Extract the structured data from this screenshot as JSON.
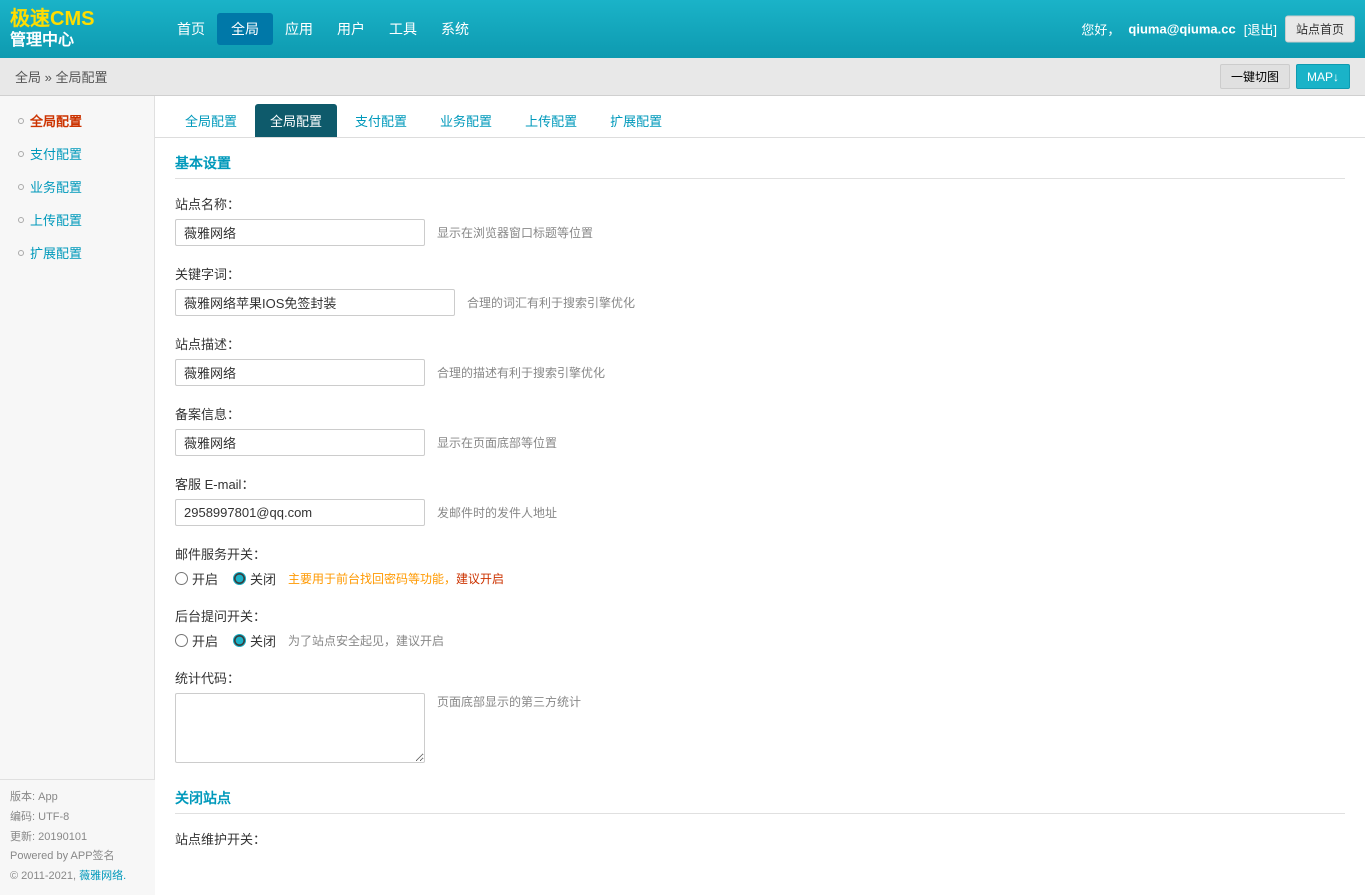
{
  "logo": {
    "line1": "极速CMS",
    "line2": "管理中心"
  },
  "nav": {
    "items": [
      {
        "label": "首页",
        "active": false
      },
      {
        "label": "全局",
        "active": true
      },
      {
        "label": "应用",
        "active": false
      },
      {
        "label": "用户",
        "active": false
      },
      {
        "label": "工具",
        "active": false
      },
      {
        "label": "系统",
        "active": false
      }
    ]
  },
  "topRight": {
    "greeting": "您好，",
    "username": "qiuma@qiuma.cc",
    "logout": "退出",
    "siteHome": "站点首页"
  },
  "breadcrumb": {
    "root": "全局",
    "separator": "»",
    "current": "全局配置",
    "actions": [
      {
        "label": "一键切图"
      },
      {
        "label": "MAP↓"
      }
    ]
  },
  "sidebar": {
    "items": [
      {
        "label": "全局配置",
        "active": true
      },
      {
        "label": "支付配置",
        "active": false
      },
      {
        "label": "业务配置",
        "active": false
      },
      {
        "label": "上传配置",
        "active": false
      },
      {
        "label": "扩展配置",
        "active": false
      }
    ],
    "footer": {
      "version_label": "版本:",
      "version_value": "App",
      "encoding_label": "编码:",
      "encoding_value": "UTF-8",
      "update_label": "更新:",
      "update_value": "20190101",
      "powered_by": "Powered by APP签名",
      "copyright": "© 2011-2021,",
      "copyright_link": "薇雅网络."
    }
  },
  "subTabs": [
    {
      "label": "全局配置",
      "state": "link"
    },
    {
      "label": "全局配置",
      "state": "active"
    },
    {
      "label": "支付配置",
      "state": "normal"
    },
    {
      "label": "业务配置",
      "state": "normal"
    },
    {
      "label": "上传配置",
      "state": "normal"
    },
    {
      "label": "扩展配置",
      "state": "normal"
    }
  ],
  "basicSettings": {
    "title": "基本设置",
    "fields": {
      "siteName": {
        "label": "站点名称：",
        "value": "薇雅网络",
        "hint": "显示在浏览器窗口标题等位置"
      },
      "keywords": {
        "label": "关键字词：",
        "value": "薇雅网络苹果IOS免签封装",
        "hint": "合理的词汇有利于搜索引擎优化"
      },
      "description": {
        "label": "站点描述：",
        "value": "薇雅网络",
        "hint": "合理的描述有利于搜索引擎优化"
      },
      "icp": {
        "label": "备案信息：",
        "value": "薇雅网络",
        "hint": "显示在页面底部等位置"
      },
      "email": {
        "label": "客服 E-mail：",
        "value": "2958997801@qq.com",
        "hint": "发邮件时的发件人地址"
      },
      "mailService": {
        "label": "邮件服务开关：",
        "open_label": "开启",
        "close_label": "关闭",
        "selected": "close",
        "hint": "主要用于前台找回密码等功能，",
        "hint_action": "建议开启"
      },
      "adminTip": {
        "label": "后台提问开关：",
        "open_label": "开启",
        "close_label": "关闭",
        "selected": "close",
        "hint": "为了站点安全起见，建议开启"
      },
      "statsCode": {
        "label": "统计代码：",
        "value": "",
        "hint": "页面底部显示的第三方统计"
      }
    }
  },
  "closeSection": {
    "title": "关闭站点",
    "maintenance": {
      "label": "站点维护开关："
    }
  }
}
